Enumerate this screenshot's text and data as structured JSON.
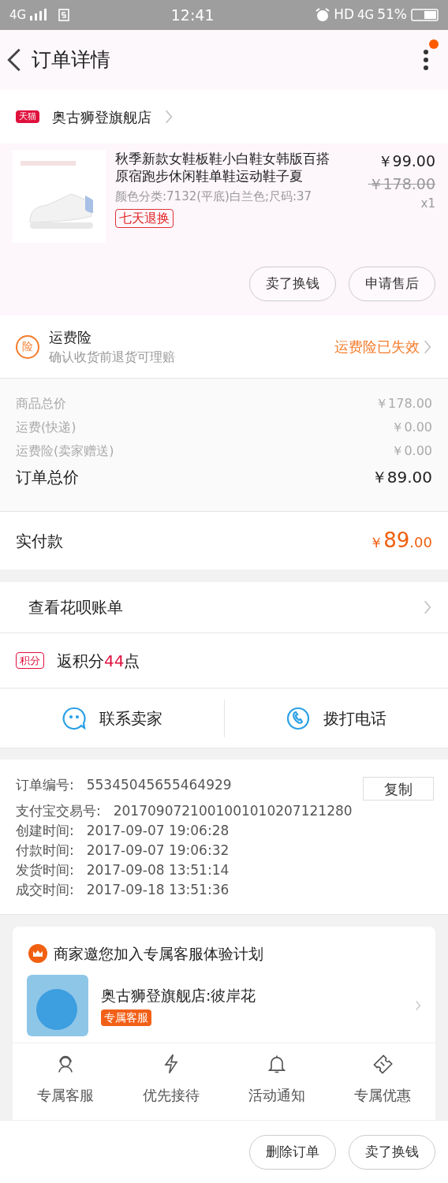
{
  "status_bar": {
    "network": "4G",
    "time": "12:41",
    "hd": "HD",
    "network_right": "4G",
    "battery": "51%"
  },
  "header": {
    "title": "订单详情",
    "has_notification": true
  },
  "shop": {
    "badge": "天猫",
    "name": "奥古狮登旗舰店"
  },
  "product": {
    "title": "秋季新款女鞋板鞋小白鞋女韩版百搭原宿跑步休闲鞋单鞋运动鞋子夏",
    "spec": "颜色分类:7132(平底)白兰色;尺码:37",
    "tag": "七天退换",
    "price": "￥99.00",
    "original_price": "￥178.00",
    "quantity": "x1"
  },
  "product_actions": [
    "卖了换钱",
    "申请售后"
  ],
  "insurance": {
    "icon_text": "险",
    "title": "运费险",
    "subtitle": "确认收货前退货可理赔",
    "status": "运费险已失效"
  },
  "costs": [
    {
      "label": "商品总价",
      "value": "￥178.00",
      "kind": "minor"
    },
    {
      "label": "运费(快递)",
      "value": "￥0.00",
      "kind": "minor"
    },
    {
      "label": "运费险(卖家赠送)",
      "value": "￥0.00",
      "kind": "minor"
    },
    {
      "label": "订单总价",
      "value": "￥89.00",
      "kind": "total"
    }
  ],
  "paid": {
    "label": "实付款",
    "currency": "￥",
    "integer": "89",
    "decimals": ".00"
  },
  "huabei": {
    "label": "查看花呗账单"
  },
  "points": {
    "badge": "积分",
    "text": "返积分**44**点"
  },
  "contact": [
    {
      "label": "联系卖家",
      "kind": "chat"
    },
    {
      "label": "拨打电话",
      "kind": "phone"
    }
  ],
  "order_info": {
    "copy_button": "复制",
    "rows": [
      {
        "label": "订单编号:",
        "value": "55345045655464929"
      },
      {
        "label": "支付宝交易号:",
        "value": "2017090721001001010207121280"
      },
      {
        "label": "创建时间:",
        "value": "2017-09-07 19:06:28"
      },
      {
        "label": "付款时间:",
        "value": "2017-09-07 19:06:32"
      },
      {
        "label": "发货时间:",
        "value": "2017-09-08 13:51:14"
      },
      {
        "label": "成交时间:",
        "value": "2017-09-18 13:51:36"
      }
    ]
  },
  "service_card": {
    "title": "商家邀您加入专属客服体验计划",
    "agent": "奥古狮登旗舰店:彼岸花",
    "agent_tag": "专属客服",
    "perks": [
      {
        "label": "专属客服",
        "kind": "headset"
      },
      {
        "label": "优先接待",
        "kind": "bolt"
      },
      {
        "label": "活动通知",
        "kind": "bell"
      },
      {
        "label": "专属优惠",
        "kind": "ticket"
      }
    ]
  },
  "bottom_actions": [
    "删除订单",
    "卖了换钱"
  ]
}
